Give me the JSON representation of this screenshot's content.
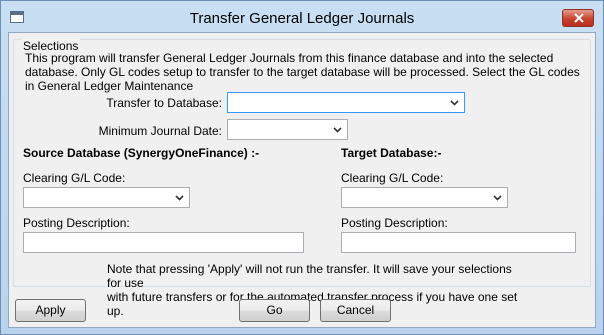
{
  "window": {
    "title": "Transfer General Ledger Journals",
    "app_icon": "window-app-icon",
    "close_icon": "close-x-icon",
    "close_color": "#c8422e"
  },
  "selections": {
    "legend": "Selections",
    "intro_text": "This program will transfer General Ledger Journals from this finance database and into the selected database. Only GL codes setup to transfer to the target database will be processed.  Select the GL codes in General Ledger Maintenance",
    "transfer_to_database": {
      "label": "Transfer to Database:",
      "value": ""
    },
    "minimum_journal_date": {
      "label": "Minimum Journal Date:",
      "value": ""
    }
  },
  "source": {
    "heading": "Source Database (SynergyOneFinance) :-",
    "clearing_label": "Clearing G/L Code:",
    "clearing_value": "",
    "posting_label": "Posting Description:",
    "posting_value": ""
  },
  "target": {
    "heading": "Target Database:-",
    "clearing_label": "Clearing G/L Code:",
    "clearing_value": "",
    "posting_label": "Posting Description:",
    "posting_value": ""
  },
  "note": "Note that pressing 'Apply' will not run the transfer.  It will save your selections for use\nwith future transfers or for the automated transfer process if you have one set up.",
  "buttons": {
    "apply": "Apply",
    "go": "Go",
    "cancel": "Cancel"
  }
}
